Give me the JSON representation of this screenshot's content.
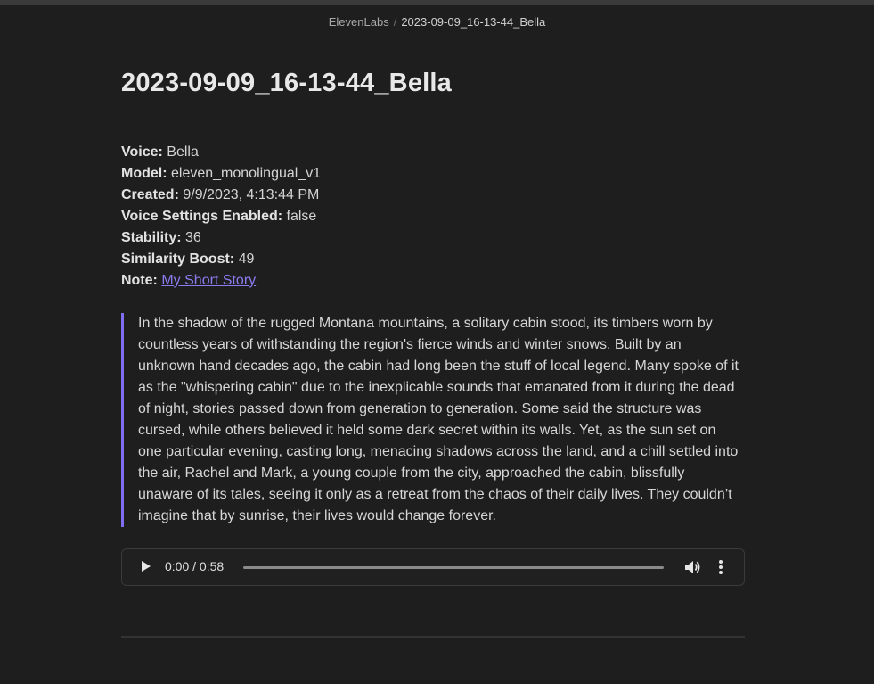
{
  "breadcrumb": {
    "root": "ElevenLabs",
    "separator": "/",
    "current": "2023-09-09_16-13-44_Bella"
  },
  "page": {
    "title": "2023-09-09_16-13-44_Bella"
  },
  "meta": {
    "voice_label": "Voice:",
    "voice_value": "Bella",
    "model_label": "Model:",
    "model_value": "eleven_monolingual_v1",
    "created_label": "Created:",
    "created_value": "9/9/2023, 4:13:44 PM",
    "settings_label": "Voice Settings Enabled:",
    "settings_value": "false",
    "stability_label": "Stability:",
    "stability_value": "36",
    "similarity_label": "Similarity Boost:",
    "similarity_value": "49",
    "note_label": "Note:",
    "note_link": "My Short Story"
  },
  "story": {
    "text": "In the shadow of the rugged Montana mountains, a solitary cabin stood, its timbers worn by countless years of withstanding the region's fierce winds and winter snows. Built by an unknown hand decades ago, the cabin had long been the stuff of local legend. Many spoke of it as the \"whispering cabin\" due to the inexplicable sounds that emanated from it during the dead of night, stories passed down from generation to generation. Some said the structure was cursed, while others believed it held some dark secret within its walls. Yet, as the sun set on one particular evening, casting long, menacing shadows across the land, and a chill settled into the air, Rachel and Mark, a young couple from the city, approached the cabin, blissfully unaware of its tales, seeing it only as a retreat from the chaos of their daily lives. They couldn’t imagine that by sunrise, their lives would change forever."
  },
  "player": {
    "time": "0:00 / 0:58",
    "progress": 0,
    "play_icon": "play-icon",
    "volume_icon": "volume-icon",
    "more_icon": "more-vertical-icon"
  },
  "colors": {
    "background": "#1e1e1e",
    "accent": "#7f6df2",
    "link": "#8b7cf0"
  }
}
